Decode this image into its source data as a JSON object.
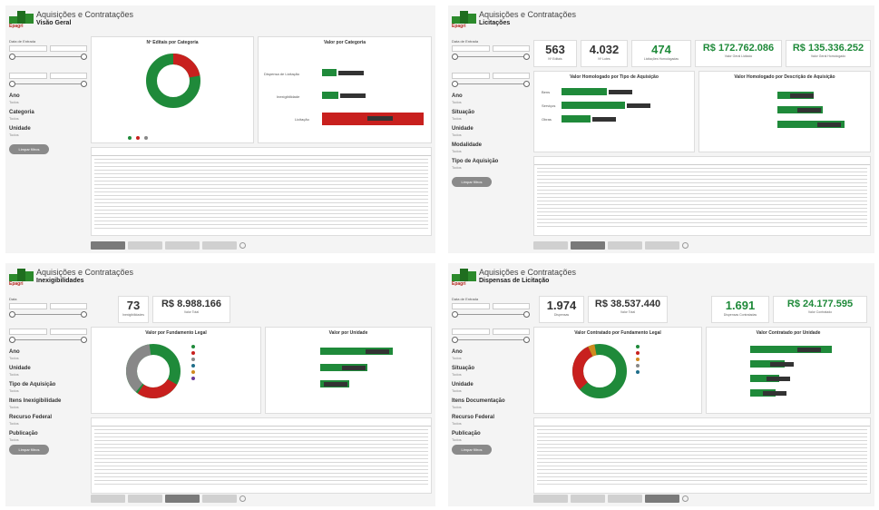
{
  "app_title": "Aquisições e Contratações",
  "logo_text": "Epagri",
  "q1": {
    "page_title": "Visão Geral",
    "donut_title": "Nº Editais por Categoria",
    "donut_pct": {
      "green": 0.78,
      "red": 0.22
    },
    "bars_title": "Valor por Categoria",
    "bars": [
      {
        "label": "Dispensa de Licitação",
        "value": 0.12,
        "color": "green"
      },
      {
        "label": "Inexigibilidade",
        "value": 0.14,
        "color": "green"
      },
      {
        "label": "Licitação",
        "value": 0.85,
        "color": "red"
      }
    ],
    "sidebar": {
      "date_label": "Data de Entrada",
      "year_label": "Ano",
      "year_value": "Todos",
      "cat_label": "Categoria",
      "cat_value": "Todos",
      "unit_label": "Unidade",
      "unit_value": "Todos",
      "clear": "Limpar filtros"
    }
  },
  "q2": {
    "page_title": "Licitações",
    "kpis": [
      {
        "value": "563",
        "label": "Nº Editais",
        "green": false
      },
      {
        "value": "4.032",
        "label": "Nº Lotes",
        "green": false
      },
      {
        "value": "474",
        "label": "Licitações Homologadas",
        "green": true
      },
      {
        "value": "R$ 172.762.086",
        "label": "Valor Geral Licitado",
        "green": true
      },
      {
        "value": "R$ 135.336.252",
        "label": "Valor Geral Homologado",
        "green": true
      }
    ],
    "chart1_title": "Valor Homologado por Tipo de Aquisição",
    "chart2_title": "Valor Homologado por Descrição de Aquisição",
    "bars1": [
      {
        "label": "Bens",
        "value": 0.45
      },
      {
        "label": "Serviços",
        "value": 0.62
      },
      {
        "label": "Obras",
        "value": 0.28
      }
    ],
    "bars2": [
      {
        "label": "",
        "value": 0.45
      },
      {
        "label": "",
        "value": 0.55
      },
      {
        "label": "",
        "value": 0.75
      }
    ],
    "sidebar": {
      "date_label": "Data de Entrada",
      "year_label": "Ano",
      "year_value": "Todos",
      "sit_label": "Situação",
      "sit_value": "Todos",
      "unit_label": "Unidade",
      "unit_value": "Todos",
      "mod_label": "Modalidade",
      "mod_value": "Todos",
      "tipo_label": "Tipo de Aquisição",
      "tipo_value": "Todos",
      "clear": "Limpar filtros"
    }
  },
  "q3": {
    "page_title": "Inexigibilidades",
    "kpis": [
      {
        "value": "73",
        "label": "Inexigibilidades"
      },
      {
        "value": "R$ 8.988.166",
        "label": "Valor Total"
      }
    ],
    "donut_title": "Valor por Fundamento Legal",
    "bars_title": "Valor por Unidade",
    "bars": [
      {
        "label": "",
        "value": 0.75
      },
      {
        "label": "",
        "value": 0.48
      },
      {
        "label": "",
        "value": 0.28
      }
    ],
    "sidebar": {
      "date_label": "Data",
      "year_label": "Ano",
      "year_value": "Todos",
      "unit_label": "Unidade",
      "unit_value": "Todos",
      "tipo_label": "Tipo de Aquisição",
      "tipo_value": "Todos",
      "item_label": "Itens Inexigibilidade",
      "item_value": "Todos",
      "rec_label": "Recurso Federal",
      "rec_value": "Todos",
      "pub_label": "Publicação",
      "pub_value": "Todos",
      "clear": "Limpar filtros"
    }
  },
  "q4": {
    "page_title": "Dispensas de Licitação",
    "kpis": [
      {
        "value": "1.974",
        "label": "Dispensas",
        "green": false
      },
      {
        "value": "R$ 38.537.440",
        "label": "Valor Total",
        "green": false
      },
      {
        "value": "1.691",
        "label": "Dispensas Contratadas",
        "green": true
      },
      {
        "value": "R$ 24.177.595",
        "label": "Valor Contratado",
        "green": true
      }
    ],
    "donut_title": "Valor Contratado por Fundamento Legal",
    "bars_title": "Valor Contratado por Unidade",
    "bars": [
      {
        "label": "",
        "value": 0.55
      },
      {
        "label": "",
        "value": 0.22
      },
      {
        "label": "",
        "value": 0.18
      },
      {
        "label": "",
        "value": 0.16
      }
    ],
    "sidebar": {
      "date_label": "Data de Entrada",
      "year_label": "Ano",
      "year_value": "Todos",
      "sit_label": "Situação",
      "sit_value": "Todos",
      "unit_label": "Unidade",
      "unit_value": "Todos",
      "item_label": "Itens Documentação",
      "item_value": "Todos",
      "rec_label": "Recurso Federal",
      "rec_value": "Todos",
      "pub_label": "Publicação",
      "pub_value": "Todos",
      "clear": "Limpar filtros"
    }
  }
}
